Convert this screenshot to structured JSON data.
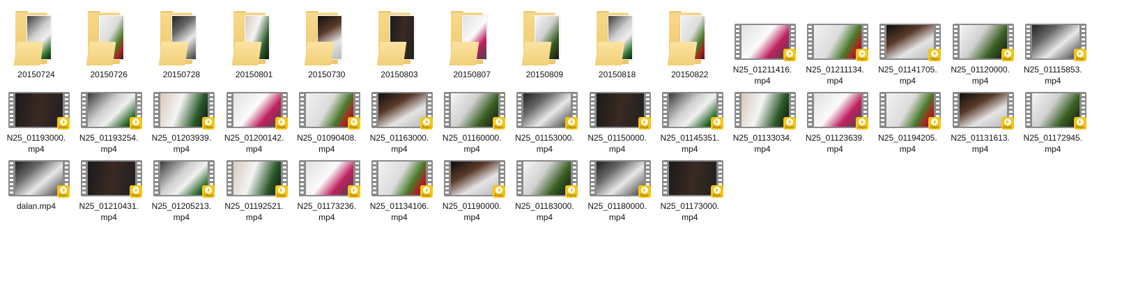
{
  "items": [
    {
      "type": "folder",
      "label": "20150724"
    },
    {
      "type": "folder",
      "label": "20150726"
    },
    {
      "type": "folder",
      "label": "20150728"
    },
    {
      "type": "folder",
      "label": "20150801"
    },
    {
      "type": "folder",
      "label": "20150730"
    },
    {
      "type": "folder",
      "label": "20150803"
    },
    {
      "type": "folder",
      "label": "20150807"
    },
    {
      "type": "folder",
      "label": "20150809"
    },
    {
      "type": "folder",
      "label": "20150818"
    },
    {
      "type": "folder",
      "label": "20150822"
    },
    {
      "type": "video",
      "label": "N25_01211416.\nmp4"
    },
    {
      "type": "video",
      "label": "N25_01211134.\nmp4"
    },
    {
      "type": "video",
      "label": "N25_01141705.\nmp4"
    },
    {
      "type": "video",
      "label": "N25_01120000.\nmp4"
    },
    {
      "type": "video",
      "label": "N25_01115853.\nmp4"
    },
    {
      "type": "video",
      "label": "N25_01193000.\nmp4"
    },
    {
      "type": "video",
      "label": "N25_01193254.\nmp4"
    },
    {
      "type": "video",
      "label": "N25_01203939.\nmp4"
    },
    {
      "type": "video",
      "label": "N25_01200142.\nmp4"
    },
    {
      "type": "video",
      "label": "N25_01090408.\nmp4"
    },
    {
      "type": "video",
      "label": "N25_01163000.\nmp4"
    },
    {
      "type": "video",
      "label": "N25_01160000.\nmp4"
    },
    {
      "type": "video",
      "label": "N25_01153000.\nmp4"
    },
    {
      "type": "video",
      "label": "N25_01150000.\nmp4"
    },
    {
      "type": "video",
      "label": "N25_01145351.\nmp4"
    },
    {
      "type": "video",
      "label": "N25_01133034.\nmp4"
    },
    {
      "type": "video",
      "label": "N25_01123639.\nmp4"
    },
    {
      "type": "video",
      "label": "N25_01194205.\nmp4"
    },
    {
      "type": "video",
      "label": "N25_01131613.\nmp4"
    },
    {
      "type": "video",
      "label": "N25_01172945.\nmp4"
    },
    {
      "type": "video",
      "label": "dalan.mp4"
    },
    {
      "type": "video",
      "label": "N25_01210431.\nmp4"
    },
    {
      "type": "video",
      "label": "N25_01205213.\nmp4"
    },
    {
      "type": "video",
      "label": "N25_01192521.\nmp4"
    },
    {
      "type": "video",
      "label": "N25_01173236.\nmp4"
    },
    {
      "type": "video",
      "label": "N25_01134106.\nmp4"
    },
    {
      "type": "video",
      "label": "N25_01190000.\nmp4"
    },
    {
      "type": "video",
      "label": "N25_01183000.\nmp4"
    },
    {
      "type": "video",
      "label": "N25_01180000.\nmp4"
    },
    {
      "type": "video",
      "label": "N25_01173000.\nmp4"
    }
  ],
  "badge": {
    "text": "Player"
  },
  "colors": {
    "folder": "#f2cf78",
    "badge": "#f5c518",
    "text": "#111111"
  }
}
